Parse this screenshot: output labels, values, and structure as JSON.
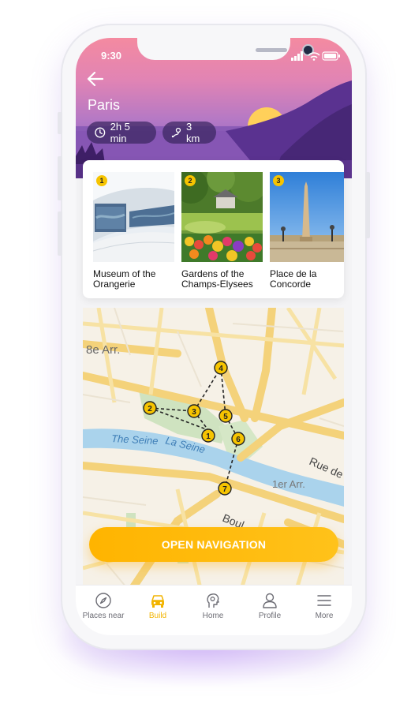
{
  "status_bar": {
    "time": "9:30"
  },
  "header": {
    "title": "Paris",
    "duration": "2h 5 min",
    "distance": "3 km"
  },
  "places": [
    {
      "number": "1",
      "name": "Museum of the Orangerie"
    },
    {
      "number": "2",
      "name": "Gardens of the Champs-Elysees"
    },
    {
      "number": "3",
      "name": "Place de la Concorde"
    }
  ],
  "map": {
    "labels": {
      "district": "8e Arr.",
      "river_en": "The Seine",
      "river_fr": "La Seine",
      "arr1": "1er Arr.",
      "rue": "Rue de",
      "boul": "Boul"
    },
    "stops": [
      "1",
      "2",
      "3",
      "4",
      "5",
      "6",
      "7"
    ]
  },
  "cta": {
    "label": "OPEN NAVIGATION"
  },
  "tabbar": {
    "items": [
      {
        "label": "Places near",
        "icon": "compass-icon",
        "active": false
      },
      {
        "label": "Build",
        "icon": "car-icon",
        "active": true
      },
      {
        "label": "Home",
        "icon": "location-head-icon",
        "active": false
      },
      {
        "label": "Profile",
        "icon": "person-icon",
        "active": false
      },
      {
        "label": "More",
        "icon": "menu-icon",
        "active": false
      }
    ]
  },
  "colors": {
    "accent": "#f2b400",
    "pill_bg": "#3a2660",
    "sky_top": "#f48aa0",
    "sky_bottom": "#7a4aa8"
  }
}
